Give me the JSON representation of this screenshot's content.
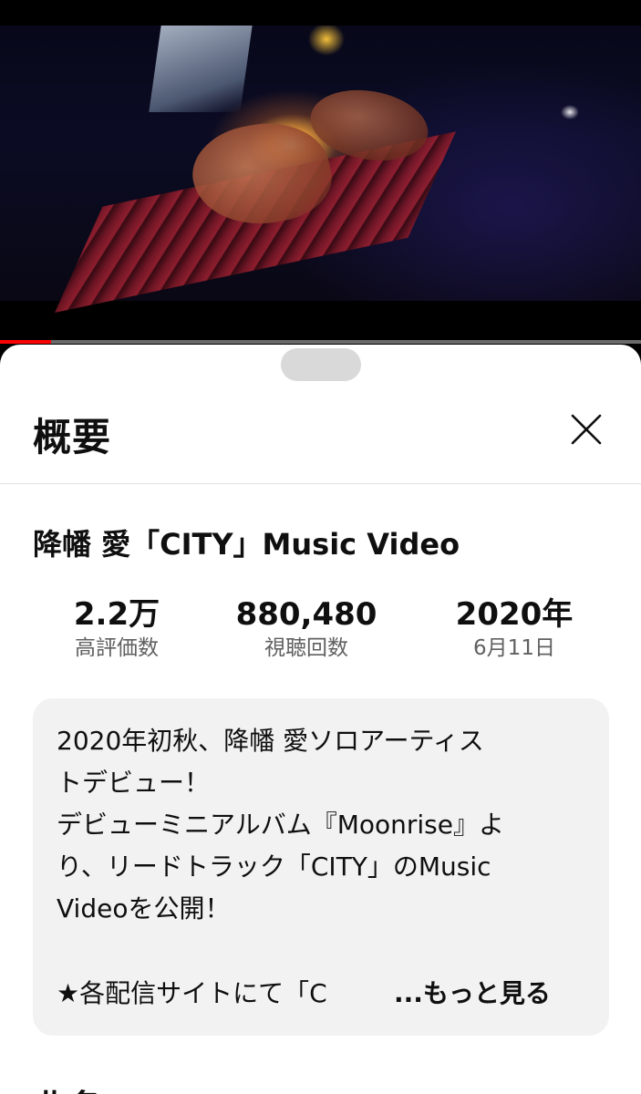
{
  "video": {
    "progress_fraction": 0.08
  },
  "panel": {
    "title": "概要",
    "close_icon": "close-icon"
  },
  "video_info": {
    "title": "降幡 愛「CITY」Music Video",
    "stats": {
      "likes_value": "2.2万",
      "likes_label": "高評価数",
      "views_value": "880,480",
      "views_label": "視聴回数",
      "year_value": "2020年",
      "date_label": "6月11日"
    }
  },
  "description": {
    "text": "2020年初秋、降幡 愛ソロアーティス\nトデビュー！\nデビューミニアルバム『Moonrise』よ\nり、リードトラック「CITY」のMusic\nVideoを公開！",
    "last_line": "★各配信サイトにて「C",
    "more_label": "...もっと見る"
  },
  "next_section": {
    "heading": "曲名"
  }
}
